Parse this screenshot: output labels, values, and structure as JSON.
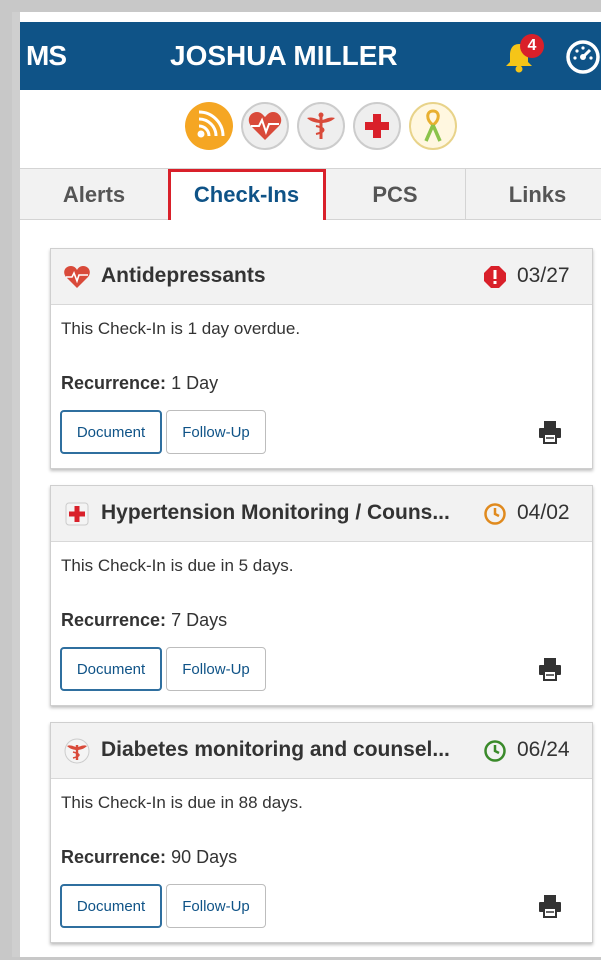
{
  "header": {
    "logo": "MS",
    "user_name": "JOSHUA MILLER",
    "notification_count": "4",
    "icons": [
      "bell-icon",
      "dashboard-gauge-icon"
    ]
  },
  "programs": [
    {
      "name": "wireless-program-icon",
      "color": "#f5a623"
    },
    {
      "name": "heart-program-icon",
      "color": "#d94a3a"
    },
    {
      "name": "caduceus-program-icon",
      "color": "#d94a3a"
    },
    {
      "name": "red-cross-program-icon",
      "color": "#d9202a"
    },
    {
      "name": "ribbon-program-icon",
      "color": "#8bc34a"
    }
  ],
  "tabs": [
    {
      "label": "Alerts",
      "active": false
    },
    {
      "label": "Check-Ins",
      "active": true
    },
    {
      "label": "PCS",
      "active": false
    },
    {
      "label": "Links",
      "active": false
    }
  ],
  "cards": [
    {
      "icon": "heart-icon",
      "title": "Antidepressants",
      "status_icon": "alert-icon",
      "status_color": "#d9202a",
      "date": "03/27",
      "due_text": "This Check-In is 1 day overdue.",
      "recurrence_label": "Recurrence:",
      "recurrence_value": "1 Day",
      "document_label": "Document",
      "followup_label": "Follow-Up"
    },
    {
      "icon": "red-cross-icon",
      "title": "Hypertension Monitoring / Couns...",
      "status_icon": "clock-icon",
      "status_color": "#e08a1e",
      "date": "04/02",
      "due_text": "This Check-In is due in 5 days.",
      "recurrence_label": "Recurrence:",
      "recurrence_value": "7 Days",
      "document_label": "Document",
      "followup_label": "Follow-Up"
    },
    {
      "icon": "caduceus-icon",
      "title": "Diabetes monitoring and counsel...",
      "status_icon": "clock-icon",
      "status_color": "#3a8a2a",
      "date": "06/24",
      "due_text": "This Check-In is due in 88 days.",
      "recurrence_label": "Recurrence:",
      "recurrence_value": "90 Days",
      "document_label": "Document",
      "followup_label": "Follow-Up"
    }
  ]
}
